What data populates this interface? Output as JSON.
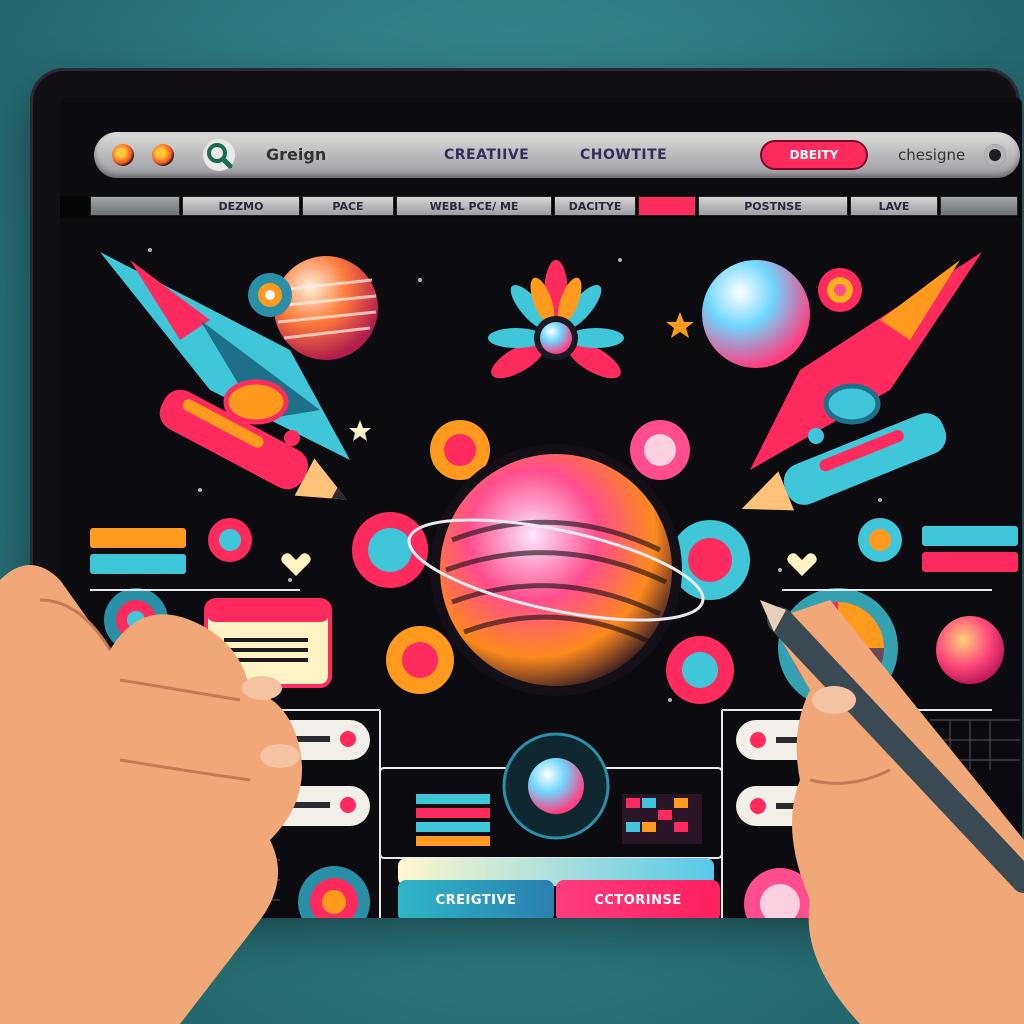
{
  "window": {
    "brand": "Greign",
    "nav": [
      "CREATIIVE",
      "CHOWTITE"
    ],
    "action_button": "DBEITY",
    "right_label": "chesigne"
  },
  "tabs": [
    "DEZMO",
    "PACE",
    "WEBL PCE/ ME",
    "DACITYE",
    "POSTNSE",
    "LAVE"
  ],
  "controls": {
    "bottom_left_button": "CREIGTIVE",
    "bottom_right_button": "CCTORINSE"
  },
  "colors": {
    "accent_pink": "#ff2b5e",
    "accent_cyan": "#3fc7d9",
    "accent_orange": "#ff9a1f",
    "screen_bg": "#0c0b10"
  },
  "icons": [
    "search-icon",
    "planet-icon",
    "flower-icon",
    "rocket-icon",
    "pen-icon",
    "palette-icon",
    "window-icon",
    "heart-icon",
    "star-icon"
  ]
}
